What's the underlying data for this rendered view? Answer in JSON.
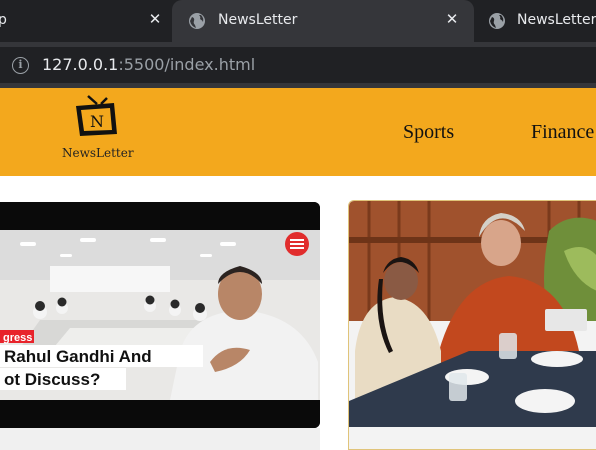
{
  "browser": {
    "tabs": [
      {
        "title": "p",
        "close": "✕"
      },
      {
        "title": "NewsLetter",
        "close": "✕"
      },
      {
        "title": "NewsLetter"
      }
    ],
    "url": {
      "host": "127.0.0.1",
      "rest": ":5500/index.html"
    }
  },
  "site": {
    "logo_letter": "N",
    "logo_text": "NewsLetter",
    "nav": [
      "Sports",
      "Finance"
    ]
  },
  "cards": {
    "card1": {
      "tag": "gress",
      "headline_line1": "Rahul Gandhi And",
      "headline_line2": "ot Discuss?"
    }
  },
  "colors": {
    "header": "#f3a81d",
    "chrome_dark": "#202124",
    "chrome_tab": "#35363a"
  }
}
